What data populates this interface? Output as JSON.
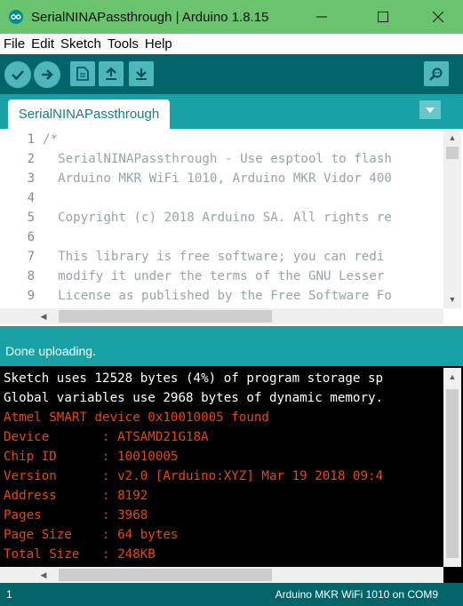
{
  "window": {
    "title": "SerialNINAPassthrough | Arduino 1.8.15",
    "minimize_glyph": "—",
    "maximize_glyph": "☐",
    "close_glyph": "✕"
  },
  "menu": [
    "File",
    "Edit",
    "Sketch",
    "Tools",
    "Help"
  ],
  "toolbar": {
    "buttons": [
      "verify-icon",
      "upload-icon",
      "new-icon",
      "open-icon",
      "save-icon"
    ],
    "serial_monitor": "serial-monitor-icon"
  },
  "tabs": [
    {
      "label": "SerialNINAPassthrough"
    }
  ],
  "editor": {
    "line_numbers": [
      "1",
      "2",
      "3",
      "4",
      "5",
      "6",
      "7",
      "8",
      "9"
    ],
    "lines": [
      "/*",
      "  SerialNINAPassthrough - Use esptool to flash",
      "  Arduino MKR WiFi 1010, Arduino MKR Vidor 400",
      "",
      "  Copyright (c) 2018 Arduino SA. All rights re",
      "",
      "  This library is free software; you can redi",
      "  modify it under the terms of the GNU Lesser ",
      "  License as published by the Free Software Fo"
    ]
  },
  "status": {
    "message": "Done uploading."
  },
  "console": {
    "lines": [
      {
        "text": "Sketch uses 12528 bytes (4%) of program storage sp",
        "color": "white"
      },
      {
        "text": "Global variables use 2968 bytes of dynamic memory.",
        "color": "white"
      },
      {
        "text": "Atmel SMART device 0x10010005 found",
        "color": "orange"
      },
      {
        "text": "Device       : ATSAMD21G18A",
        "color": "orange"
      },
      {
        "text": "Chip ID      : 10010005",
        "color": "orange"
      },
      {
        "text": "Version      : v2.0 [Arduino:XYZ] Mar 19 2018 09:4",
        "color": "orange"
      },
      {
        "text": "Address      : 8192",
        "color": "orange"
      },
      {
        "text": "Pages        : 3968",
        "color": "orange"
      },
      {
        "text": "Page Size    : 64 bytes",
        "color": "orange"
      },
      {
        "text": "Total Size   : 248KB",
        "color": "orange"
      }
    ]
  },
  "footer": {
    "line": "1",
    "board": "Arduino MKR WiFi 1010 on COM9"
  },
  "colors": {
    "title_bar": "#6ac46d",
    "toolbar": "#006468",
    "teal": "#17a1a5",
    "console_orange": "#e34c00"
  }
}
